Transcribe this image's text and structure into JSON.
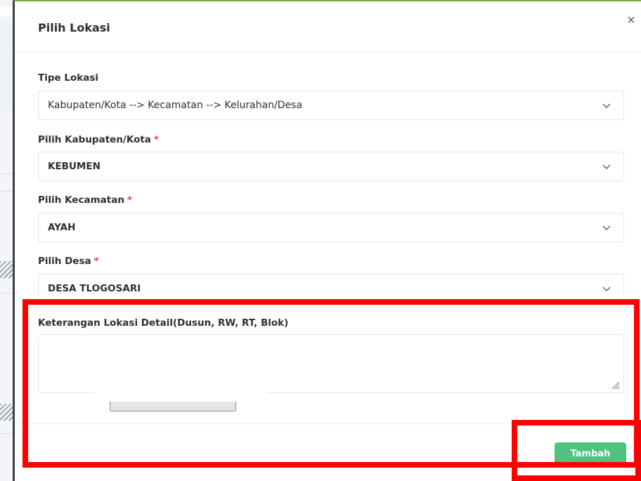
{
  "modal": {
    "title": "Pilih Lokasi",
    "close_glyph": "×"
  },
  "form": {
    "location_type": {
      "label": "Tipe Lokasi",
      "value": "Kabupaten/Kota --> Kecamatan --> Kelurahan/Desa"
    },
    "regency": {
      "label": "Pilih Kabupaten/Kota",
      "required_mark": "*",
      "value": "KEBUMEN"
    },
    "district": {
      "label": "Pilih Kecamatan",
      "required_mark": "*",
      "value": "AYAH"
    },
    "village": {
      "label": "Pilih Desa",
      "required_mark": "*",
      "value": "DESA TLOGOSARI"
    },
    "detail": {
      "label": "Keterangan Lokasi Detail(Dusun, RW, RT, Blok)",
      "value": ""
    }
  },
  "footer": {
    "submit_label": "Tambah"
  },
  "colors": {
    "primary_button": "#4fc27f",
    "required": "#e64545",
    "annotation": "#ff0000",
    "top_accent": "#6fae3c"
  },
  "icons": {
    "close": "close-icon",
    "dropdown": "chevron-down-icon",
    "resize": "resize-grip-icon"
  }
}
